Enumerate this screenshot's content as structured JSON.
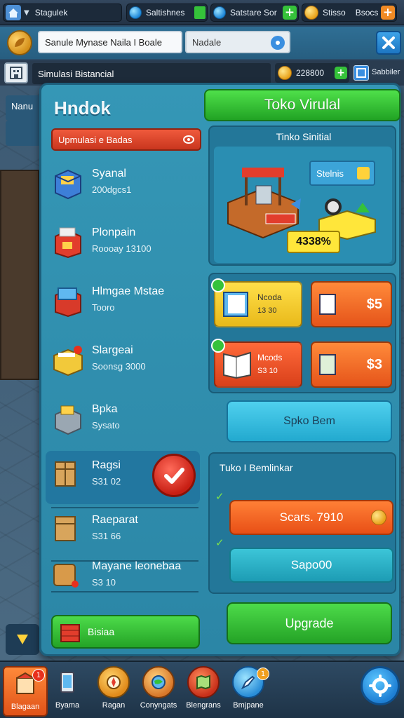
{
  "topbar": {
    "title": "Stagulek",
    "resource1": "Saltishnes",
    "resource2": "Satstare Sor",
    "resource3": "Stisso",
    "resource4": "Bsocs"
  },
  "addrbar": {
    "search_value": "Sanule Mynase Naila I Boale",
    "filter_value": "Nadale"
  },
  "simbar": {
    "title": "Simulasi Bistancial",
    "currency_value": "228800",
    "right_label": "Sabbiler"
  },
  "inventory": {
    "title": "Hndok",
    "tab_label": "Upmulasi e Badas",
    "items": [
      {
        "name": "Syanal",
        "sub": "200dgcs1"
      },
      {
        "name": "Plonpain",
        "sub": "Roooay 13100"
      },
      {
        "name": "Hlmgae Mstae",
        "sub": "Tooro"
      },
      {
        "name": "Slargeai",
        "sub": "Soonsg 3000"
      },
      {
        "name": "Bpka",
        "sub": "Sysato"
      },
      {
        "name": "Ragsi",
        "sub": "S31 02"
      },
      {
        "name": "Raeparat",
        "sub": "S31 66"
      },
      {
        "name": "Mayane leonebaa",
        "sub": "S3 10"
      }
    ],
    "bottom_label": "Bisiaa"
  },
  "store": {
    "title": "Toko Virulal",
    "shop_header": "Tinko Sinitial",
    "tag_label": "Stelnis",
    "percent": "4338%",
    "offers": [
      {
        "name": "Ncoda",
        "sub": "13 30"
      },
      {
        "name": "Mcods",
        "sub": "S3 10"
      }
    ],
    "prices": [
      "$5",
      "$3"
    ],
    "split_button": "Spko Bem",
    "upgrade_header": "Tuko I Bemlinkar",
    "buy_label": "Scars. 7910",
    "teal_label": "Sapo00",
    "upgrade_label": "Upgrade"
  },
  "bottomnav": {
    "items": [
      {
        "label": "Blagaan",
        "badge": "1"
      },
      {
        "label": "Byama",
        "badge": ""
      },
      {
        "label": "Ragan",
        "badge": ""
      },
      {
        "label": "Conyngats",
        "badge": ""
      },
      {
        "label": "Blengrans",
        "badge": ""
      },
      {
        "label": "Bmjpane",
        "badge": "1"
      }
    ]
  },
  "colors": {
    "panel": "#3597b6",
    "green": "#24a326",
    "orange": "#e5541a",
    "red": "#c9361e",
    "cyan": "#22a9cf"
  }
}
